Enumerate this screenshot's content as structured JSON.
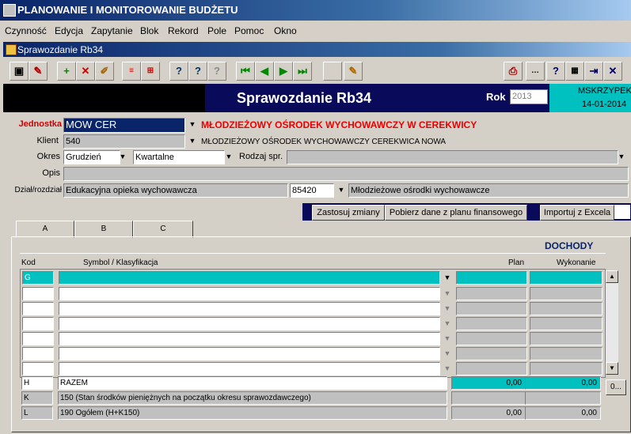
{
  "app": {
    "title": "PLANOWANIE I MONITOROWANIE BUDŻETU"
  },
  "menu": [
    "Czynność",
    "Edycja",
    "Zapytanie",
    "Blok",
    "Rekord",
    "Pole",
    "Pomoc",
    "Okno"
  ],
  "window": {
    "title": "Sprawozdanie Rb34"
  },
  "header": {
    "title": "Sprawozdanie Rb34",
    "rok_label": "Rok",
    "rok_value": "2013",
    "user": "MSKRZYPEK",
    "date": "14-01-2014"
  },
  "form": {
    "jednostka_label": "Jednostka",
    "jednostka_value": "MOW CER",
    "jednostka_name": "MŁODZIEŻOWY OŚRODEK WYCHOWAWCZY W CEREKWICY",
    "klient_label": "Klient",
    "klient_value": "540",
    "klient_name": "MŁODZIEŻOWY OŚRODEK WYCHOWAWCZY CEREKWICA NOWA",
    "okres_label": "Okres",
    "okres_value": "Grudzień",
    "okres_type": "Kwartalne",
    "rodzaj_label": "Rodzaj spr.",
    "rodzaj_value": "",
    "opis_label": "Opis",
    "opis_value": "",
    "dzial_label": "Dział/rozdział",
    "dzial_value": "Edukacyjna opieka wychowawcza",
    "rozdzial_code": "85420",
    "rozdzial_name": "Młodzieżowe ośrodki wychowawcze"
  },
  "actions": {
    "apply": "Zastosuj zmiany",
    "fetch": "Pobierz dane  z planu finansowego",
    "import": "Importuj z Excela"
  },
  "tabs": [
    "A",
    "B",
    "C"
  ],
  "grid": {
    "section_title": "DOCHODY",
    "col_kod": "Kod",
    "col_symbol": "Symbol / Klasyfikacja",
    "col_plan": "Plan",
    "col_wykonanie": "Wykonanie",
    "first_code": "G",
    "empty_rows": 6,
    "summary": [
      {
        "code": "H",
        "label": "RAZEM",
        "plan": "0,00",
        "wykonanie": "0,00"
      },
      {
        "code": "K",
        "label": "150 (Stan środków pieniężnych na początku okresu sprawozdawczego)",
        "plan": "",
        "wykonanie": ""
      },
      {
        "code": "L",
        "label": "190 Ogółem (H+K150)",
        "plan": "0,00",
        "wykonanie": "0,00"
      }
    ],
    "more_button": "0..."
  },
  "icons": [
    "save-icon",
    "new-icon",
    "add-icon",
    "delete-icon",
    "edit-icon",
    "first-icon",
    "prev-icon",
    "next-icon",
    "last-icon",
    "help-icon",
    "calc-icon",
    "close-icon"
  ]
}
